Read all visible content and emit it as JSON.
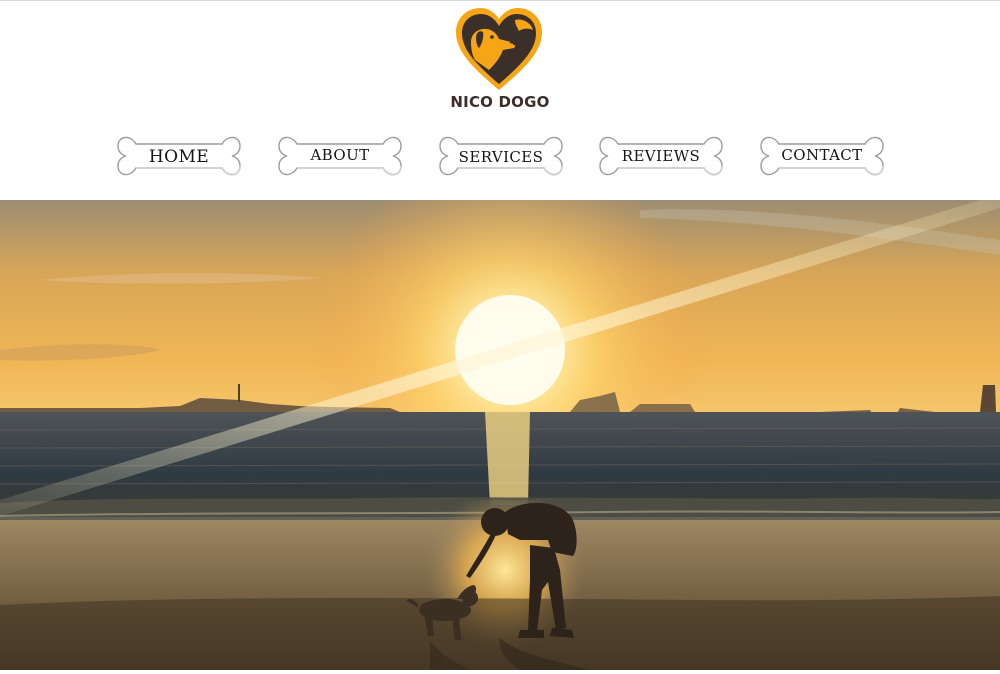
{
  "brand": {
    "name": "NICO DOGO",
    "logo_icon": "dog-heart-icon",
    "accent": "#f5a515",
    "dark": "#3a2f29"
  },
  "nav": {
    "items": [
      {
        "label": "HOME"
      },
      {
        "label": "ABOUT"
      },
      {
        "label": "SERVICES"
      },
      {
        "label": "REVIEWS"
      },
      {
        "label": "CONTACT"
      }
    ],
    "icon": "dog-bone-icon"
  },
  "hero": {
    "image_subject": "sunset-beach-photo",
    "palette": [
      "#f3a34a",
      "#fbe3a0",
      "#1d2f3a",
      "#6d5433"
    ]
  }
}
